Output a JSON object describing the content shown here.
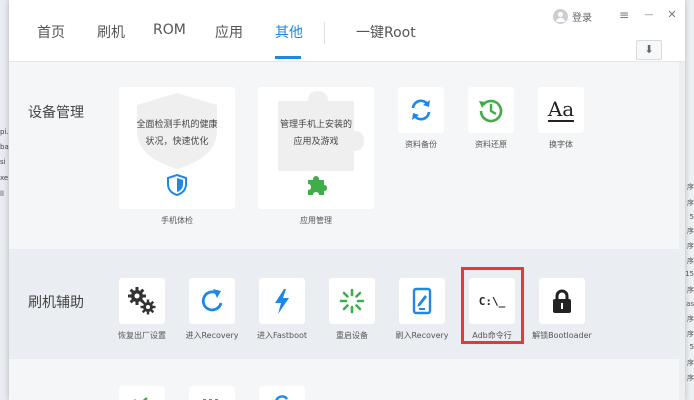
{
  "nav": {
    "tabs": [
      {
        "label": "首页"
      },
      {
        "label": "刷机"
      },
      {
        "label": "ROM"
      },
      {
        "label": "应用"
      },
      {
        "label": "其他"
      },
      {
        "label": "一键Root"
      }
    ],
    "active_tab": "其他",
    "login_label": "登录",
    "menu_glyph": "≡",
    "minimize_glyph": "—",
    "close_glyph": "✕",
    "download_glyph": "⬇"
  },
  "device_management": {
    "title": "设备管理",
    "cards": [
      {
        "desc_line1": "全面检测手机的健康",
        "desc_line2": "状况，快速优化",
        "caption": "手机体检",
        "icon": "shield-icon"
      },
      {
        "desc_line1": "管理手机上安装的",
        "desc_line2": "应用及游戏",
        "caption": "应用管理",
        "icon": "puzzle-icon"
      }
    ],
    "tools": [
      {
        "label": "资料备份",
        "icon": "sync-icon"
      },
      {
        "label": "资料还原",
        "icon": "restore-clock-icon"
      },
      {
        "label": "换字体",
        "icon": "font-icon",
        "glyph": "Aa"
      }
    ]
  },
  "flash_assist": {
    "title": "刷机辅助",
    "tools": [
      {
        "label": "恢复出厂设置",
        "icon": "gears-icon"
      },
      {
        "label": "进入Recovery",
        "icon": "refresh-icon"
      },
      {
        "label": "进入Fastboot",
        "icon": "lightning-icon"
      },
      {
        "label": "重启设备",
        "icon": "spinner-icon"
      },
      {
        "label": "刷入Recovery",
        "icon": "tablet-edit-icon"
      },
      {
        "label": "Adb命令行",
        "icon": "terminal-icon",
        "glyph": "C:\\_"
      },
      {
        "label": "解锁Bootloader",
        "icon": "lock-icon"
      }
    ]
  },
  "colors": {
    "accent": "#1e88e5",
    "green": "#3fae49",
    "highlight": "#e53935"
  },
  "background": {
    "left_fragments": [
      "pi.s",
      "ba",
      "si",
      "xe",
      "ll"
    ],
    "right_fragments": [
      "序",
      "序",
      "5",
      "序",
      "序",
      "序",
      "15",
      "序",
      "as",
      "序",
      "序",
      "5",
      "序",
      "序"
    ]
  }
}
